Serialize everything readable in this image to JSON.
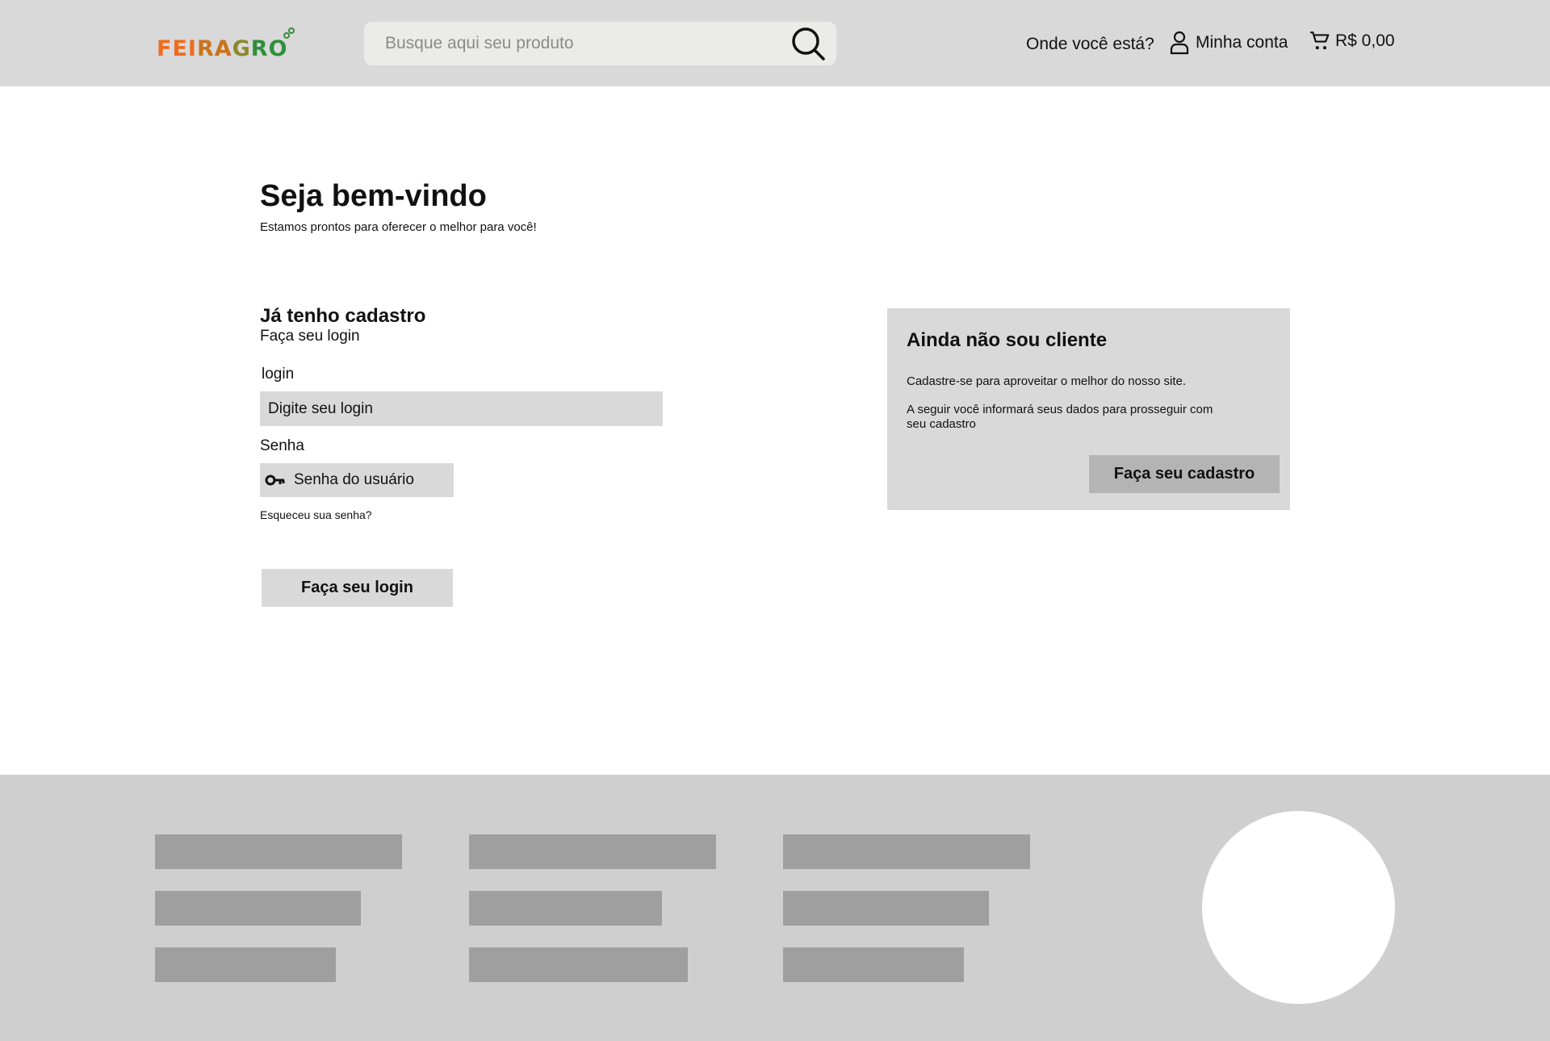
{
  "header": {
    "logo": "FEIRAGRO",
    "search_placeholder": "Busque aqui seu produto",
    "location_label": "Onde você está?",
    "account_label": "Minha conta",
    "cart_total": "R$ 0,00"
  },
  "welcome": {
    "title": "Seja bem-vindo",
    "subtitle": "Estamos prontos para oferecer o melhor para você!"
  },
  "login": {
    "title": "Já tenho cadastro",
    "subtitle": "Faça seu login",
    "login_label": "login",
    "login_placeholder": "Digite seu login",
    "password_label": "Senha",
    "password_placeholder": "Senha do usuário",
    "forgot_link": "Esqueceu sua senha?",
    "submit_button": "Faça seu login"
  },
  "register": {
    "title": "Ainda não sou cliente",
    "text1": "Cadastre-se para aproveitar o melhor do nosso site.",
    "text2": "A seguir você informará seus dados para prosseguir com seu cadastro",
    "button": "Faça seu cadastro"
  },
  "colors": {
    "header_bg": "#d9d9d9",
    "footer_bg": "#cfcfcf",
    "footer_placeholder": "#a09f9f",
    "logo_orange": "#ee6b1e",
    "logo_green": "#2f8f3a"
  }
}
